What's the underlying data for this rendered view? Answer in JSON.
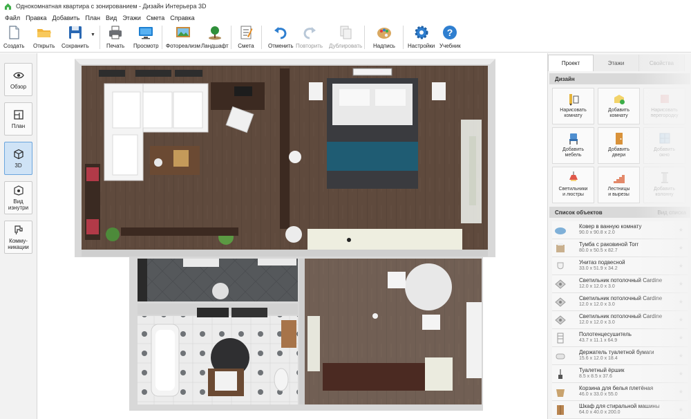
{
  "window": {
    "title": "Однокомнатная квартира с зонированием - Дизайн Интерьера 3D"
  },
  "menu": [
    "Файл",
    "Правка",
    "Добавить",
    "План",
    "Вид",
    "Этажи",
    "Смета",
    "Справка"
  ],
  "toolbar": {
    "create": "Создать",
    "open": "Открыть",
    "save": "Сохранить",
    "print": "Печать",
    "preview": "Просмотр",
    "photorealism": "Фотореализм",
    "landscape": "Ландшафт",
    "estimate": "Смета",
    "undo": "Отменить",
    "redo": "Повторить",
    "duplicate": "Дублировать",
    "label": "Надпись",
    "settings": "Настройки",
    "tutorial": "Учебник"
  },
  "views": {
    "overview": "Обзор",
    "plan": "План",
    "view3d": "3D",
    "inside": "Вид изнутри",
    "inside_l1": "Вид",
    "inside_l2": "изнутри",
    "comm_l1": "Комму-",
    "comm_l2": "никации",
    "active": "3D"
  },
  "panel": {
    "tabs": [
      "Проект",
      "Этажи",
      "Свойства"
    ],
    "active_tab": "Проект",
    "design_header": "Дизайн",
    "design_buttons": [
      {
        "l1": "Нарисовать",
        "l2": "комнату",
        "icon": "pencil-room-icon"
      },
      {
        "l1": "Добавить",
        "l2": "комнату",
        "icon": "add-room-icon"
      },
      {
        "l1": "Нарисовать",
        "l2": "перегородку",
        "icon": "partition-icon"
      },
      {
        "l1": "Добавить",
        "l2": "мебель",
        "icon": "chair-icon"
      },
      {
        "l1": "Добавить",
        "l2": "двери",
        "icon": "door-icon"
      },
      {
        "l1": "Добавить",
        "l2": "окно",
        "icon": "window-icon"
      },
      {
        "l1": "Светильники",
        "l2": "и люстры",
        "icon": "lamp-icon"
      },
      {
        "l1": "Лестницы",
        "l2": "и вырезы",
        "icon": "stairs-icon"
      },
      {
        "l1": "Добавить",
        "l2": "колонну",
        "icon": "column-icon"
      }
    ],
    "objects_header": "Список объектов",
    "objects_hint": "Вид списка",
    "objects": [
      {
        "name": "Ковер в ванную комнату",
        "size": "90.0 x 90.8 x 2.0"
      },
      {
        "name": "Тумба с раковиной Torr",
        "size": "80.0 x 50.5 x 82.7"
      },
      {
        "name": "Унитаз подвесной",
        "size": "33.0 x 51.9 x 34.2"
      },
      {
        "name": "Светильник потолочный Cardine",
        "size": "12.0 x 12.0 x 3.0"
      },
      {
        "name": "Светильник потолочный Cardine",
        "size": "12.0 x 12.0 x 3.0"
      },
      {
        "name": "Светильник потолочный Cardine",
        "size": "12.0 x 12.0 x 3.0"
      },
      {
        "name": "Полотенцесушитель",
        "size": "43.7 x 11.1 x 64.9"
      },
      {
        "name": "Держатель туалетной бумаги",
        "size": "15.6 x 12.0 x 18.4"
      },
      {
        "name": "Туалетный ёршик",
        "size": "8.5 x 8.5 x 37.6"
      },
      {
        "name": "Корзина для белья плетёная",
        "size": "46.0 x 33.0 x 55.0"
      },
      {
        "name": "Шкаф для стиральной машины",
        "size": "64.0 x 40.0 x 200.0"
      }
    ]
  },
  "colors": {
    "accent": "#2f7fd0",
    "floor_wood": "#5f4a3d",
    "tile_dark": "#56595c",
    "wall": "#d9d9d9",
    "bed_teal": "#1f5c73"
  }
}
